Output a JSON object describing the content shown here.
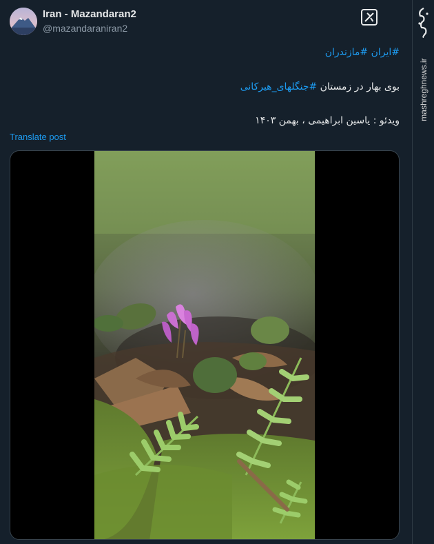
{
  "author": {
    "display_name": "Iran - Mazandaran2",
    "handle": "@mazandaraniran2"
  },
  "post": {
    "hashtag_line": "#ایران #مازندران",
    "line2_text": "بوی بهار در زمستان ",
    "line2_hashtag": "#جنگلهای_هیرکانی",
    "line3": "ویدئو : یاسین ابراهیمی ، بهمن ۱۴۰۳",
    "translate_label": "Translate post"
  },
  "media": {
    "type": "video",
    "subject": "pink cyclamen flower with moss and ferns"
  },
  "watermark": {
    "site": "mashreghnews.ir"
  },
  "colors": {
    "background": "#15202b",
    "link": "#1d9bf0",
    "text": "#e7e9ea",
    "muted": "#8b98a5"
  },
  "icons": {
    "grok": "grok-icon",
    "avatar": "mountain-avatar"
  }
}
